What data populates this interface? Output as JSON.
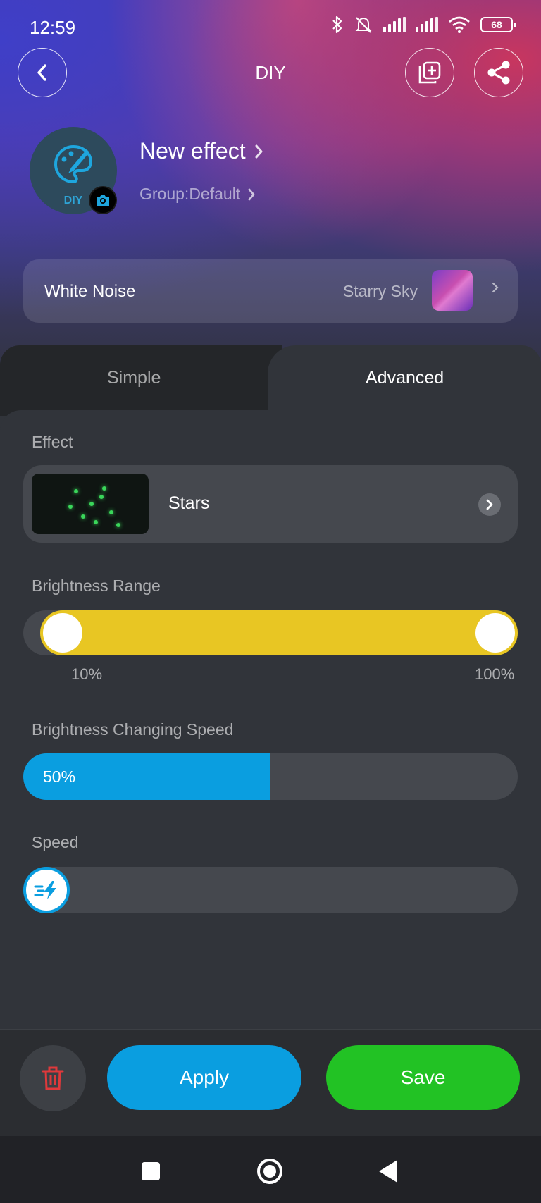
{
  "status_bar": {
    "time": "12:59",
    "battery": "68"
  },
  "nav": {
    "title": "DIY"
  },
  "profile": {
    "avatar_label": "DIY",
    "name": "New effect",
    "group": "Group:Default"
  },
  "white_noise": {
    "label": "White Noise",
    "value": "Starry Sky"
  },
  "tabs": [
    {
      "label": "Simple",
      "active": false
    },
    {
      "label": "Advanced",
      "active": true
    }
  ],
  "effect": {
    "label": "Effect",
    "selected": "Stars"
  },
  "brightness_range": {
    "label": "Brightness Range",
    "min_label": "10%",
    "max_label": "100%",
    "min": 10,
    "max": 100
  },
  "brightness_speed": {
    "label": "Brightness Changing Speed",
    "value_label": "50%",
    "value": 50
  },
  "speed": {
    "label": "Speed",
    "value": 0
  },
  "actions": {
    "apply": "Apply",
    "save": "Save"
  },
  "colors": {
    "accent_blue": "#0a9ee0",
    "range_yellow": "#e8c623",
    "save_green": "#22c224",
    "delete_red": "#e0393b"
  },
  "icons": [
    "back-icon",
    "add-copy-icon",
    "share-icon",
    "palette-brush-icon",
    "camera-icon",
    "chevron-right-icon",
    "speed-bolt-icon",
    "trash-icon",
    "square-icon",
    "circle-home-icon",
    "triangle-back-icon"
  ]
}
